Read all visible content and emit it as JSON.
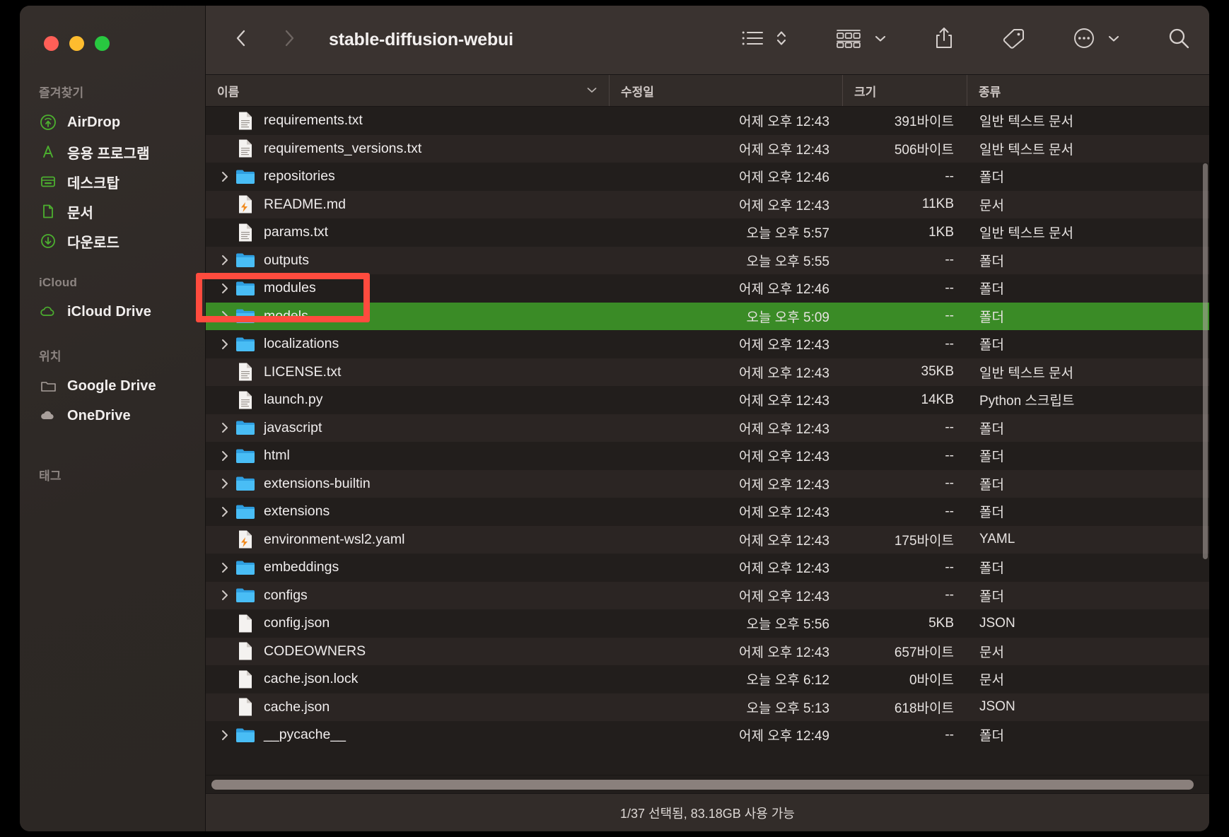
{
  "window": {
    "title": "stable-diffusion-webui",
    "traffic_lights": [
      "close-button",
      "minimize-button",
      "maximize-button"
    ]
  },
  "toolbar": {
    "back_icon": "chevron-left-icon",
    "forward_icon": "chevron-right-icon",
    "view_icon": "list-view-icon",
    "view_sort_icon": "chevron-up-down-icon",
    "group_icon": "group-by-icon",
    "group_chevron_icon": "chevron-down-icon",
    "share_icon": "share-icon",
    "tag_icon": "tag-icon",
    "more_icon": "more-ellipsis-icon",
    "more_chevron_icon": "chevron-down-icon",
    "search_icon": "search-icon"
  },
  "sidebar": {
    "sections": [
      {
        "label": "즐겨찾기",
        "items": [
          {
            "label": "AirDrop",
            "icon": "airdrop-icon",
            "color": "#4caf2f"
          },
          {
            "label": "응용 프로그램",
            "icon": "applications-icon",
            "color": "#4caf2f"
          },
          {
            "label": "데스크탑",
            "icon": "desktop-icon",
            "color": "#4caf2f"
          },
          {
            "label": "문서",
            "icon": "documents-icon",
            "color": "#4caf2f"
          },
          {
            "label": "다운로드",
            "icon": "downloads-icon",
            "color": "#4caf2f"
          }
        ]
      },
      {
        "label": "iCloud",
        "items": [
          {
            "label": "iCloud Drive",
            "icon": "icloud-drive-icon",
            "color": "#4caf2f"
          }
        ]
      },
      {
        "label": "위치",
        "items": [
          {
            "label": "Google Drive",
            "icon": "folder-outline-icon",
            "color": "#a89f9b"
          },
          {
            "label": "OneDrive",
            "icon": "cloud-filled-icon",
            "color": "#a89f9b"
          }
        ]
      },
      {
        "label": "태그",
        "items": []
      }
    ]
  },
  "columns": [
    {
      "key": "name",
      "label": "이름"
    },
    {
      "key": "date",
      "label": "수정일"
    },
    {
      "key": "size",
      "label": "크기"
    },
    {
      "key": "kind",
      "label": "종류"
    }
  ],
  "files": [
    {
      "name": "requirements.txt",
      "date": "어제 오후 12:43",
      "size": "391바이트",
      "kind": "일반 텍스트 문서",
      "icon": "text-file-icon",
      "expandable": false,
      "selected": false
    },
    {
      "name": "requirements_versions.txt",
      "date": "어제 오후 12:43",
      "size": "506바이트",
      "kind": "일반 텍스트 문서",
      "icon": "text-file-icon",
      "expandable": false,
      "selected": false
    },
    {
      "name": "repositories",
      "date": "어제 오후 12:46",
      "size": "--",
      "kind": "폴더",
      "icon": "folder-icon",
      "expandable": true,
      "selected": false
    },
    {
      "name": "README.md",
      "date": "어제 오후 12:43",
      "size": "11KB",
      "kind": "문서",
      "icon": "markdown-file-icon",
      "expandable": false,
      "selected": false
    },
    {
      "name": "params.txt",
      "date": "오늘 오후 5:57",
      "size": "1KB",
      "kind": "일반 텍스트 문서",
      "icon": "text-file-icon",
      "expandable": false,
      "selected": false
    },
    {
      "name": "outputs",
      "date": "오늘 오후 5:55",
      "size": "--",
      "kind": "폴더",
      "icon": "folder-icon",
      "expandable": true,
      "selected": false
    },
    {
      "name": "modules",
      "date": "어제 오후 12:46",
      "size": "--",
      "kind": "폴더",
      "icon": "folder-icon",
      "expandable": true,
      "selected": false
    },
    {
      "name": "models",
      "date": "오늘 오후 5:09",
      "size": "--",
      "kind": "폴더",
      "icon": "folder-icon",
      "expandable": true,
      "selected": true
    },
    {
      "name": "localizations",
      "date": "어제 오후 12:43",
      "size": "--",
      "kind": "폴더",
      "icon": "folder-icon",
      "expandable": true,
      "selected": false
    },
    {
      "name": "LICENSE.txt",
      "date": "어제 오후 12:43",
      "size": "35KB",
      "kind": "일반 텍스트 문서",
      "icon": "text-file-icon",
      "expandable": false,
      "selected": false
    },
    {
      "name": "launch.py",
      "date": "어제 오후 12:43",
      "size": "14KB",
      "kind": "Python 스크립트",
      "icon": "text-file-icon",
      "expandable": false,
      "selected": false
    },
    {
      "name": "javascript",
      "date": "어제 오후 12:43",
      "size": "--",
      "kind": "폴더",
      "icon": "folder-icon",
      "expandable": true,
      "selected": false
    },
    {
      "name": "html",
      "date": "어제 오후 12:43",
      "size": "--",
      "kind": "폴더",
      "icon": "folder-icon",
      "expandable": true,
      "selected": false
    },
    {
      "name": "extensions-builtin",
      "date": "어제 오후 12:43",
      "size": "--",
      "kind": "폴더",
      "icon": "folder-icon",
      "expandable": true,
      "selected": false
    },
    {
      "name": "extensions",
      "date": "어제 오후 12:43",
      "size": "--",
      "kind": "폴더",
      "icon": "folder-icon",
      "expandable": true,
      "selected": false
    },
    {
      "name": "environment-wsl2.yaml",
      "date": "어제 오후 12:43",
      "size": "175바이트",
      "kind": "YAML",
      "icon": "markdown-file-icon",
      "expandable": false,
      "selected": false
    },
    {
      "name": "embeddings",
      "date": "어제 오후 12:43",
      "size": "--",
      "kind": "폴더",
      "icon": "folder-icon",
      "expandable": true,
      "selected": false
    },
    {
      "name": "configs",
      "date": "어제 오후 12:43",
      "size": "--",
      "kind": "폴더",
      "icon": "folder-icon",
      "expandable": true,
      "selected": false
    },
    {
      "name": "config.json",
      "date": "오늘 오후 5:56",
      "size": "5KB",
      "kind": "JSON",
      "icon": "plain-file-icon",
      "expandable": false,
      "selected": false
    },
    {
      "name": "CODEOWNERS",
      "date": "어제 오후 12:43",
      "size": "657바이트",
      "kind": "문서",
      "icon": "plain-file-icon",
      "expandable": false,
      "selected": false
    },
    {
      "name": "cache.json.lock",
      "date": "오늘 오후 6:12",
      "size": "0바이트",
      "kind": "문서",
      "icon": "plain-file-icon",
      "expandable": false,
      "selected": false
    },
    {
      "name": "cache.json",
      "date": "오늘 오후 5:13",
      "size": "618바이트",
      "kind": "JSON",
      "icon": "plain-file-icon",
      "expandable": false,
      "selected": false
    },
    {
      "name": "__pycache__",
      "date": "어제 오후 12:49",
      "size": "--",
      "kind": "폴더",
      "icon": "folder-icon",
      "expandable": true,
      "selected": false
    }
  ],
  "statusbar": {
    "text": "1/37 선택됨, 83.18GB 사용 가능"
  },
  "annotation": {
    "type": "highlight-rectangle",
    "color": "#ff4b3e",
    "targets": "models"
  },
  "colors": {
    "selection_green": "#3a8b26",
    "folder_blue": "#3cb0ef",
    "sidebar_green": "#4caf2f",
    "annotation_red": "#ff4b3e"
  }
}
